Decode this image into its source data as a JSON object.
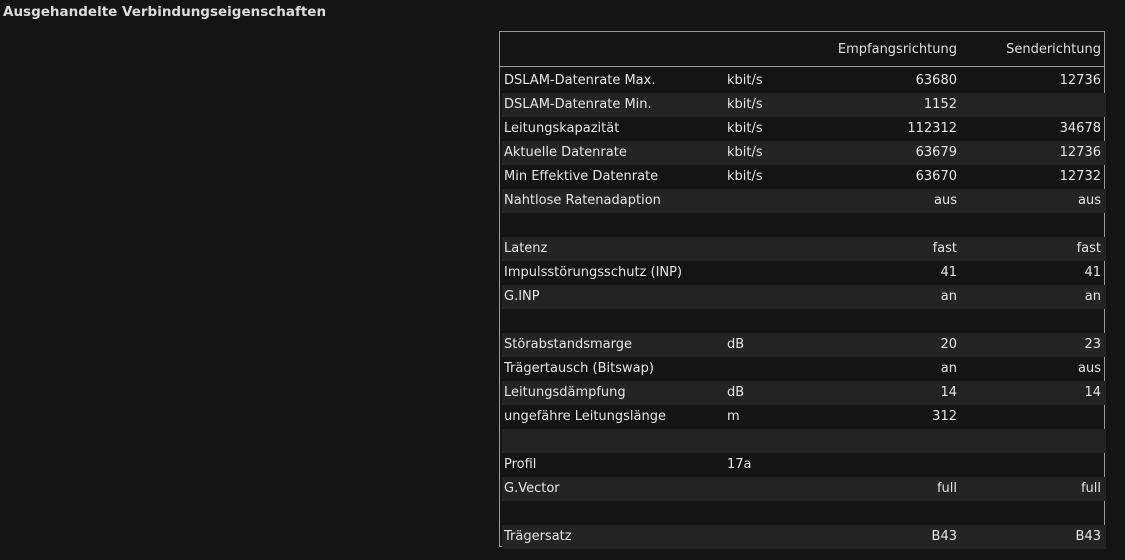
{
  "title": "Ausgehandelte Verbindungseigenschaften",
  "table": {
    "headers": {
      "downstream": "Empfangsrichtung",
      "upstream": "Senderichtung"
    },
    "rows": [
      {
        "label": "DSLAM-Datenrate Max.",
        "unit": "kbit/s",
        "down": "63680",
        "up": "12736"
      },
      {
        "label": "DSLAM-Datenrate Min.",
        "unit": "kbit/s",
        "down": "1152",
        "up": ""
      },
      {
        "label": "Leitungskapazität",
        "unit": "kbit/s",
        "down": "112312",
        "up": "34678"
      },
      {
        "label": "Aktuelle Datenrate",
        "unit": "kbit/s",
        "down": "63679",
        "up": "12736"
      },
      {
        "label": "Min Effektive Datenrate",
        "unit": "kbit/s",
        "down": "63670",
        "up": "12732"
      },
      {
        "label": "Nahtlose Ratenadaption",
        "unit": "",
        "down": "aus",
        "up": "aus"
      },
      {
        "label": "",
        "unit": "",
        "down": "",
        "up": ""
      },
      {
        "label": "Latenz",
        "unit": "",
        "down": "fast",
        "up": "fast"
      },
      {
        "label": "Impulsstörungsschutz (INP)",
        "unit": "",
        "down": "41",
        "up": "41"
      },
      {
        "label": "G.INP",
        "unit": "",
        "down": "an",
        "up": "an"
      },
      {
        "label": "",
        "unit": "",
        "down": "",
        "up": ""
      },
      {
        "label": "Störabstandsmarge",
        "unit": "dB",
        "down": "20",
        "up": "23"
      },
      {
        "label": "Trägertausch (Bitswap)",
        "unit": "",
        "down": "an",
        "up": "aus"
      },
      {
        "label": "Leitungsdämpfung",
        "unit": "dB",
        "down": "14",
        "up": "14"
      },
      {
        "label": "ungefähre Leitungslänge",
        "unit": "m",
        "down": "312",
        "up": ""
      },
      {
        "label": "",
        "unit": "",
        "down": "",
        "up": ""
      },
      {
        "label": "Profil",
        "unit": "17a",
        "down": "",
        "up": ""
      },
      {
        "label": "G.Vector",
        "unit": "",
        "down": "full",
        "up": "full"
      },
      {
        "label": "",
        "unit": "",
        "down": "",
        "up": ""
      },
      {
        "label": "Trägersatz",
        "unit": "",
        "down": "B43",
        "up": "B43"
      }
    ]
  }
}
